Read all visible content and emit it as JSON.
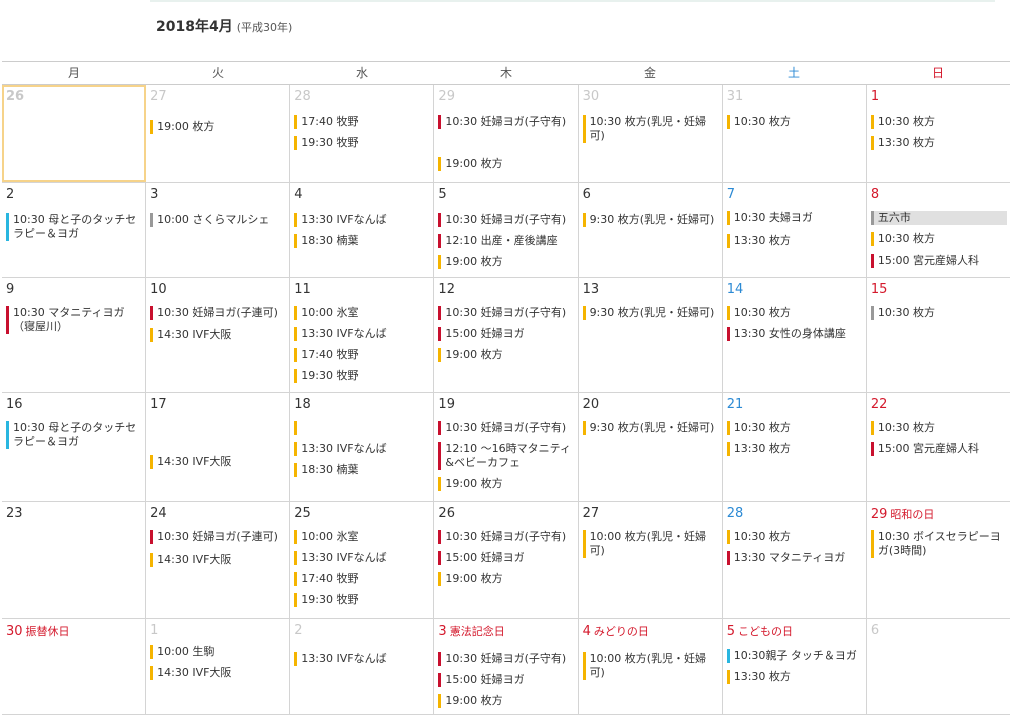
{
  "header": {
    "title": "2018年4月",
    "era": "(平成30年)"
  },
  "weekdays": [
    "月",
    "火",
    "水",
    "木",
    "金",
    "土",
    "日"
  ],
  "colors": {
    "yellow": "#f5b400",
    "red": "#c8102e",
    "blue": "#29b6e0",
    "gray": "#999999",
    "saturday": "#2c8ad4",
    "sunday": "#d4192c"
  },
  "weeks": [
    {
      "days": [
        {
          "num": "26",
          "events": []
        },
        {
          "num": "27",
          "events": [
            {
              "text": "19:00 枚方"
            }
          ]
        },
        {
          "num": "28",
          "events": [
            {
              "text": "17:40 牧野"
            },
            {
              "text": "19:30 牧野"
            }
          ]
        },
        {
          "num": "29",
          "events": [
            {
              "text": "10:30 妊婦ヨガ(子守有)",
              "color": "red"
            },
            {
              "text": "19:00 枚方"
            }
          ]
        },
        {
          "num": "30",
          "events": [
            {
              "text": "10:30 枚方(乳児・妊婦可)"
            }
          ]
        },
        {
          "num": "31",
          "events": [
            {
              "text": "10:30 枚方"
            }
          ]
        },
        {
          "num": "1",
          "events": [
            {
              "text": "10:30 枚方"
            },
            {
              "text": "13:30 枚方"
            }
          ]
        }
      ]
    },
    {
      "days": [
        {
          "num": "2",
          "events": [
            {
              "text": "10:30 母と子のタッチセラピー＆ヨガ",
              "color": "blue"
            }
          ]
        },
        {
          "num": "3",
          "events": [
            {
              "text": "10:00 さくらマルシェ",
              "color": "gray"
            }
          ]
        },
        {
          "num": "4",
          "events": [
            {
              "text": "13:30 IVFなんば"
            },
            {
              "text": "18:30 楠葉"
            }
          ]
        },
        {
          "num": "5",
          "events": [
            {
              "text": "10:30 妊婦ヨガ(子守有)",
              "color": "red"
            },
            {
              "text": "12:10 出産・産後講座",
              "color": "red"
            },
            {
              "text": "19:00 枚方"
            }
          ]
        },
        {
          "num": "6",
          "events": [
            {
              "text": "9:30 枚方(乳児・妊婦可)"
            }
          ]
        },
        {
          "num": "7",
          "events": [
            {
              "text": "10:30 夫婦ヨガ"
            },
            {
              "text": "13:30 枚方"
            }
          ]
        },
        {
          "num": "8",
          "events": [
            {
              "text": "五六市",
              "color": "gray",
              "hl": true
            },
            {
              "text": "10:30 枚方"
            },
            {
              "text": "15:00 宮元産婦人科",
              "color": "red"
            }
          ]
        }
      ]
    },
    {
      "days": [
        {
          "num": "9",
          "events": [
            {
              "text": "10:30 マタニティヨガ（寝屋川）",
              "color": "red"
            }
          ]
        },
        {
          "num": "10",
          "events": [
            {
              "text": "10:30 妊婦ヨガ(子連可)",
              "color": "red"
            },
            {
              "text": "14:30 IVF大阪"
            }
          ]
        },
        {
          "num": "11",
          "events": [
            {
              "text": "10:00 氷室"
            },
            {
              "text": "13:30 IVFなんば"
            },
            {
              "text": "17:40 牧野"
            },
            {
              "text": "19:30 牧野"
            }
          ]
        },
        {
          "num": "12",
          "events": [
            {
              "text": "10:30 妊婦ヨガ(子守有)",
              "color": "red"
            },
            {
              "text": "15:00 妊婦ヨガ",
              "color": "red"
            },
            {
              "text": "19:00 枚方"
            }
          ]
        },
        {
          "num": "13",
          "events": [
            {
              "text": "9:30 枚方(乳児・妊婦可)"
            }
          ]
        },
        {
          "num": "14",
          "events": [
            {
              "text": "10:30 枚方"
            },
            {
              "text": "13:30 女性の身体講座",
              "color": "red"
            }
          ]
        },
        {
          "num": "15",
          "events": [
            {
              "text": "10:30 枚方",
              "color": "gray"
            }
          ]
        }
      ]
    },
    {
      "days": [
        {
          "num": "16",
          "events": [
            {
              "text": "10:30 母と子のタッチセラピー＆ヨガ",
              "color": "blue"
            }
          ]
        },
        {
          "num": "17",
          "events": [
            {
              "text": "14:30 IVF大阪"
            }
          ]
        },
        {
          "num": "18",
          "events": [
            {
              "text": ""
            },
            {
              "text": "13:30 IVFなんば"
            },
            {
              "text": "18:30 楠葉"
            }
          ]
        },
        {
          "num": "19",
          "events": [
            {
              "text": "10:30 妊婦ヨガ(子守有)",
              "color": "red"
            },
            {
              "text": "12:10 ～16時マタニティ&ベビーカフェ",
              "color": "red"
            },
            {
              "text": "19:00 枚方"
            }
          ]
        },
        {
          "num": "20",
          "events": [
            {
              "text": "9:30 枚方(乳児・妊婦可)"
            }
          ]
        },
        {
          "num": "21",
          "events": [
            {
              "text": "10:30 枚方"
            },
            {
              "text": "13:30 枚方"
            }
          ]
        },
        {
          "num": "22",
          "events": [
            {
              "text": "10:30 枚方"
            },
            {
              "text": "15:00 宮元産婦人科",
              "color": "red"
            }
          ]
        }
      ]
    },
    {
      "days": [
        {
          "num": "23",
          "events": []
        },
        {
          "num": "24",
          "events": [
            {
              "text": "10:30 妊婦ヨガ(子連可)",
              "color": "red"
            },
            {
              "text": "14:30 IVF大阪"
            }
          ]
        },
        {
          "num": "25",
          "events": [
            {
              "text": "10:00 氷室"
            },
            {
              "text": "13:30 IVFなんば"
            },
            {
              "text": "17:40 牧野"
            },
            {
              "text": "19:30 牧野"
            }
          ]
        },
        {
          "num": "26",
          "events": [
            {
              "text": "10:30 妊婦ヨガ(子守有)",
              "color": "red"
            },
            {
              "text": "15:00 妊婦ヨガ",
              "color": "red"
            },
            {
              "text": "19:00 枚方"
            }
          ]
        },
        {
          "num": "27",
          "events": [
            {
              "text": "10:00 枚方(乳児・妊婦可)"
            }
          ]
        },
        {
          "num": "28",
          "events": [
            {
              "text": "10:30 枚方"
            },
            {
              "text": "13:30 マタニティヨガ",
              "color": "red"
            }
          ]
        },
        {
          "num": "29",
          "holiday": "昭和の日",
          "events": [
            {
              "text": "10:30 ボイスセラピーヨガ(3時間)"
            }
          ]
        }
      ]
    },
    {
      "days": [
        {
          "num": "30",
          "holiday": "振替休日",
          "events": []
        },
        {
          "num": "1",
          "events": [
            {
              "text": "10:00 生駒"
            },
            {
              "text": "14:30 IVF大阪"
            }
          ]
        },
        {
          "num": "2",
          "events": [
            {
              "text": "13:30 IVFなんば"
            }
          ]
        },
        {
          "num": "3",
          "holiday": "憲法記念日",
          "events": [
            {
              "text": "10:30 妊婦ヨガ(子守有)",
              "color": "red"
            },
            {
              "text": "15:00 妊婦ヨガ",
              "color": "red"
            },
            {
              "text": "19:00 枚方"
            }
          ]
        },
        {
          "num": "4",
          "holiday": "みどりの日",
          "events": [
            {
              "text": "10:00 枚方(乳児・妊婦可)"
            }
          ]
        },
        {
          "num": "5",
          "holiday": "こどもの日",
          "events": [
            {
              "text": "10:30親子 タッチ＆ヨガ",
              "color": "blue"
            },
            {
              "text": "13:30 枚方"
            }
          ]
        },
        {
          "num": "6",
          "events": []
        }
      ]
    }
  ]
}
